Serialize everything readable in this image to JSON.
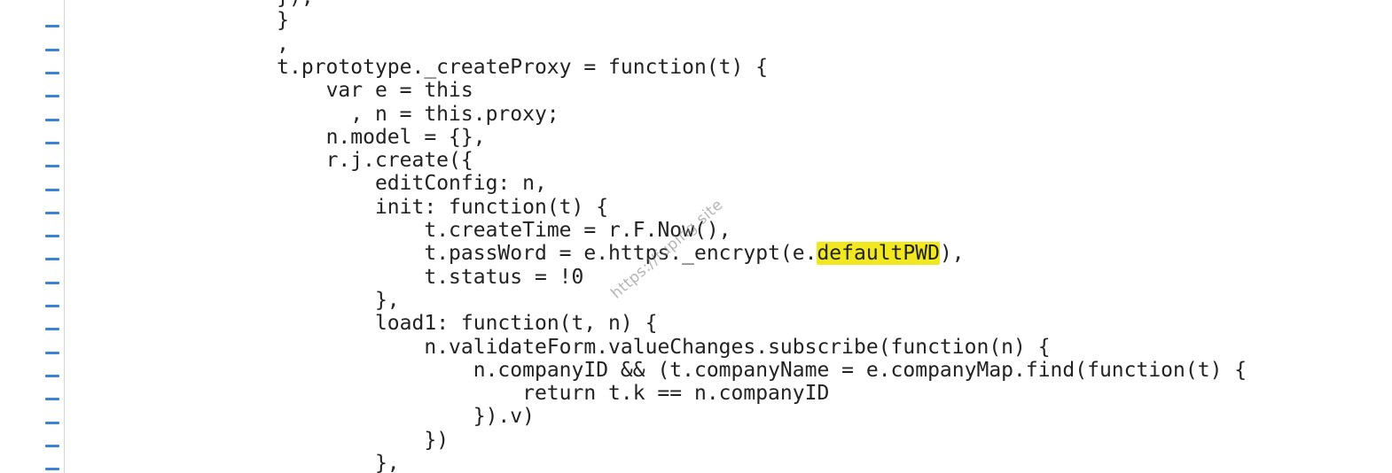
{
  "editor": {
    "colors": {
      "background": "#ffffff",
      "text": "#222222",
      "gutter_marker": "#3a83d6",
      "gutter_border": "#d6d6d6",
      "highlight": "#f1e81f"
    },
    "gutter_marker_icon": "line-changed-marker",
    "lines": [
      {
        "indent": "            ",
        "before": "});",
        "highlight": "",
        "after": ""
      },
      {
        "indent": "            ",
        "before": "}",
        "highlight": "",
        "after": ""
      },
      {
        "indent": "            ",
        "before": ",",
        "highlight": "",
        "after": ""
      },
      {
        "indent": "            ",
        "before": "t.prototype._createProxy = function(t) {",
        "highlight": "",
        "after": ""
      },
      {
        "indent": "                ",
        "before": "var e = this",
        "highlight": "",
        "after": ""
      },
      {
        "indent": "                  ",
        "before": ", n = this.proxy;",
        "highlight": "",
        "after": ""
      },
      {
        "indent": "                ",
        "before": "n.model = {},",
        "highlight": "",
        "after": ""
      },
      {
        "indent": "                ",
        "before": "r.j.create({",
        "highlight": "",
        "after": ""
      },
      {
        "indent": "                    ",
        "before": "editConfig: n,",
        "highlight": "",
        "after": ""
      },
      {
        "indent": "                    ",
        "before": "init: function(t) {",
        "highlight": "",
        "after": ""
      },
      {
        "indent": "                        ",
        "before": "t.createTime = r.F.Now(),",
        "highlight": "",
        "after": ""
      },
      {
        "indent": "                        ",
        "before": "t.passWord = e.https._encrypt(e.",
        "highlight": "defaultPWD",
        "after": "),"
      },
      {
        "indent": "                        ",
        "before": "t.status = !0",
        "highlight": "",
        "after": ""
      },
      {
        "indent": "                    ",
        "before": "},",
        "highlight": "",
        "after": ""
      },
      {
        "indent": "                    ",
        "before": "load1: function(t, n) {",
        "highlight": "",
        "after": ""
      },
      {
        "indent": "                        ",
        "before": "n.validateForm.valueChanges.subscribe(function(n) {",
        "highlight": "",
        "after": ""
      },
      {
        "indent": "                            ",
        "before": "n.companyID && (t.companyName = e.companyMap.find(function(t) {",
        "highlight": "",
        "after": ""
      },
      {
        "indent": "                                ",
        "before": "return t.k == n.companyID",
        "highlight": "",
        "after": ""
      },
      {
        "indent": "                            ",
        "before": "}).v)",
        "highlight": "",
        "after": ""
      },
      {
        "indent": "                        ",
        "before": "})",
        "highlight": "",
        "after": ""
      },
      {
        "indent": "                    ",
        "before": "},",
        "highlight": "",
        "after": ""
      }
    ]
  },
  "watermark": {
    "text": "https://fuping.site"
  }
}
